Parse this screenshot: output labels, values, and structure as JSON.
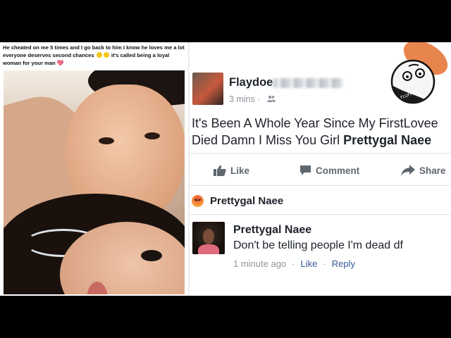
{
  "left_post": {
    "caption_part1": "He cheated on me 5 times and I go back to him I know he loves me a lot everyone deserves second chances",
    "caption_part2": "it's called being a loyal woman for your man"
  },
  "fb_post": {
    "author_name": "Flaydoe",
    "time": "3 mins",
    "privacy_icon": "friends-icon",
    "text_main": "It's Been A Whole Year Since My FirstLovee Died Damn I Miss You Girl",
    "text_tag": "Prettygal Naee",
    "actions": {
      "like": "Like",
      "comment": "Comment",
      "share": "Share"
    },
    "reaction": {
      "type": "angry",
      "name": "Prettygal Naee"
    },
    "comment": {
      "name": "Prettygal Naee",
      "text": "Don't be telling people I'm dead df",
      "time": "1 minute ago",
      "like": "Like",
      "reply": "Reply"
    }
  },
  "sticker": {
    "text": "FLUFFEE"
  },
  "colors": {
    "fb_link": "#365899",
    "fb_text": "#1d2129",
    "fb_meta": "#90949c"
  }
}
